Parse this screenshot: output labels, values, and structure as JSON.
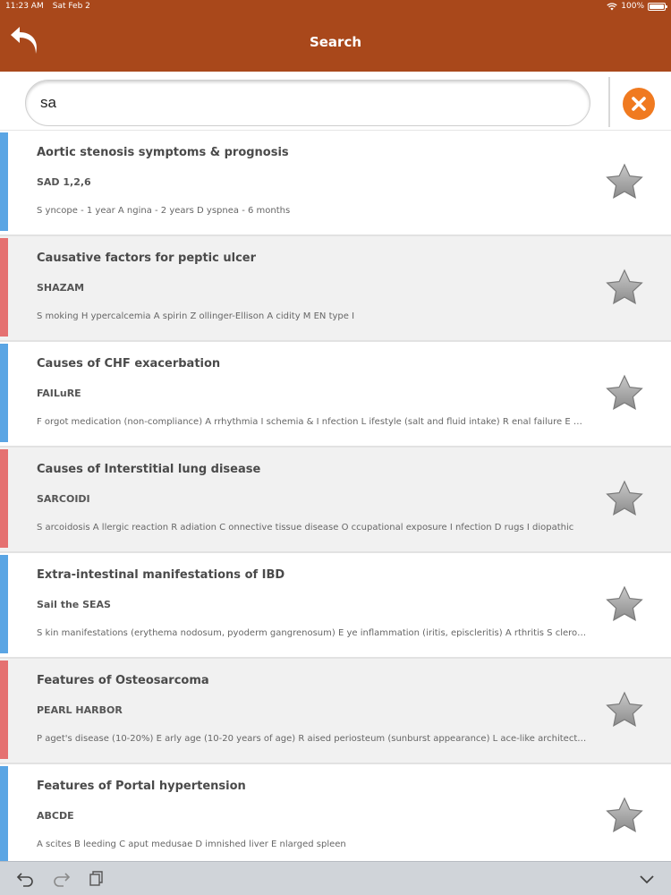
{
  "status": {
    "time": "11:23 AM",
    "date": "Sat Feb 2",
    "battery_text": "100%",
    "battery_level": 1.0
  },
  "nav": {
    "title": "Search",
    "back_icon": "back-arrow-icon"
  },
  "search": {
    "value": "sa",
    "clear_icon": "close-circle-icon"
  },
  "colors": {
    "header": "#a9481b",
    "accent_orange": "#f07a20",
    "bar_blue": "#5aa5e4",
    "bar_red": "#e57171"
  },
  "results": [
    {
      "title": "Aortic stenosis symptoms & prognosis",
      "mnemonic": "SAD 1,2,6",
      "details": "S yncope - 1 year    A ngina - 2 years    D yspnea - 6 months",
      "bar": "blue",
      "icon": "star-icon"
    },
    {
      "title": "Causative factors for peptic ulcer",
      "mnemonic": "SHAZAM",
      "details": "S moking    H ypercalcemia    A spirin    Z ollinger-Ellison    A cidity    M EN type I",
      "bar": "red",
      "icon": "star-icon"
    },
    {
      "title": "Causes of CHF exacerbation",
      "mnemonic": "FAILuRE",
      "details": "F orgot medication (non-compliance)    A rrhythmia    I schemia & I nfection    L ifestyle (salt and fluid intake)    R enal failure    E mbolism",
      "bar": "blue",
      "icon": "star-icon"
    },
    {
      "title": "Causes of Interstitial lung disease",
      "mnemonic": "SARCOIDI",
      "details": "S arcoidosis    A llergic reaction    R adiation    C onnective tissue disease    O ccupational exposure    I nfection    D rugs    I diopathic",
      "bar": "red",
      "icon": "star-icon"
    },
    {
      "title": "Extra-intestinal manifestations of IBD",
      "mnemonic": "Sail the SEAS",
      "details": "S kin manifestations (erythema nodosum, pyoderm gangrenosum)    E ye inflammation (iritis, episcleritis)    A rthritis    S clerosing cholangitis",
      "bar": "blue",
      "icon": "star-icon"
    },
    {
      "title": "Features of Osteosarcoma",
      "mnemonic": "PEARL HARBOR",
      "details": "P aget's disease (10-20%)    E arly age (10-20 years of age)    R aised periosteum (sunburst appearance)    L ace-like architecture",
      "bar": "red",
      "icon": "star-icon"
    },
    {
      "title": "Features of Portal hypertension",
      "mnemonic": "ABCDE",
      "details": "A scites    B leeding    C aput medusae    D imnished liver    E nlarged spleen",
      "bar": "blue",
      "icon": "star-icon"
    }
  ],
  "toolbar": {
    "undo_icon": "undo-icon",
    "redo_icon": "redo-icon",
    "copy_icon": "clipboard-icon",
    "collapse_icon": "chevron-down-icon"
  }
}
